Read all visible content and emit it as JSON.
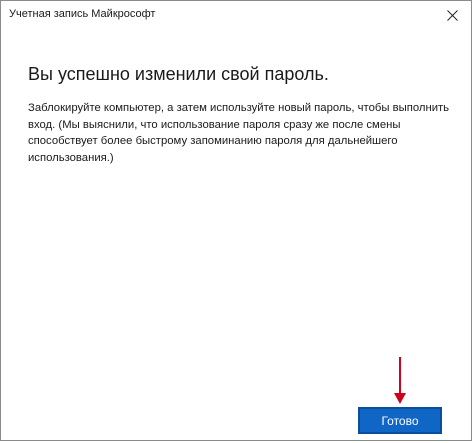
{
  "window": {
    "title": "Учетная запись Майкрософт"
  },
  "titlebar": {
    "close_icon": "close-icon"
  },
  "main": {
    "heading": "Вы успешно изменили свой пароль.",
    "message": "Заблокируйте компьютер, а затем используйте новый пароль, чтобы выполнить вход. (Мы выяснили, что использование пароля сразу же после смены способствует более быстрому запоминанию пароля для дальнейшего использования.)"
  },
  "footer": {
    "done_label": "Готово",
    "arrow_icon": "down-arrow-icon"
  },
  "colors": {
    "accent": "#0f66c5",
    "arrow": "#d0021b"
  }
}
